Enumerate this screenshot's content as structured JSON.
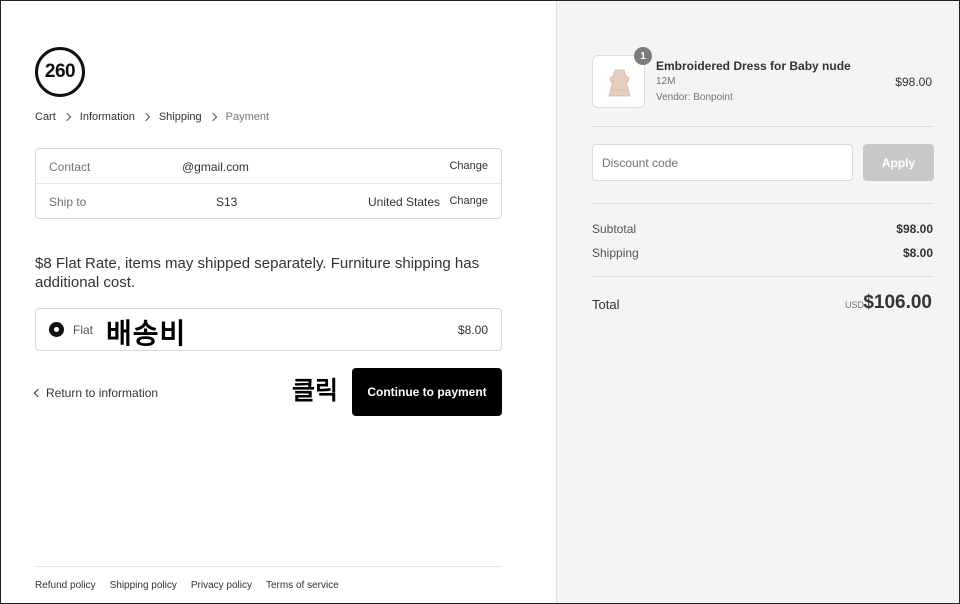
{
  "logo_text": "260",
  "breadcrumb": [
    "Cart",
    "Information",
    "Shipping",
    "Payment"
  ],
  "review": {
    "contact": {
      "label": "Contact",
      "value": "@gmail.com",
      "action": "Change"
    },
    "ship_to": {
      "label": "Ship to",
      "value": "S13",
      "country": "United States",
      "action": "Change"
    }
  },
  "shipping_notice": "$8 Flat Rate, items may shipped separately. Furniture shipping has additional cost.",
  "shipping_method": {
    "name": "Flat",
    "price": "$8.00",
    "selected": true
  },
  "annotations": {
    "shipping_fee": "배송비",
    "click": "클릭"
  },
  "actions": {
    "return": "Return to information",
    "continue": "Continue to payment"
  },
  "footer_links": [
    "Refund policy",
    "Shipping policy",
    "Privacy policy",
    "Terms of service"
  ],
  "product": {
    "quantity": "1",
    "name": "Embroidered Dress for Baby nude",
    "variant": "12M",
    "vendor": "Vendor: Bonpoint",
    "price": "$98.00",
    "icon": "dress-icon"
  },
  "discount": {
    "placeholder": "Discount code",
    "apply_label": "Apply"
  },
  "summary": {
    "subtotal_label": "Subtotal",
    "subtotal": "$98.00",
    "shipping_label": "Shipping",
    "shipping": "$8.00",
    "total_label": "Total",
    "currency": "USD",
    "total": "$106.00"
  },
  "colors": {
    "button": "#000000",
    "sidebar_bg": "#f4f4f4",
    "apply_disabled": "#c8c8c8"
  }
}
